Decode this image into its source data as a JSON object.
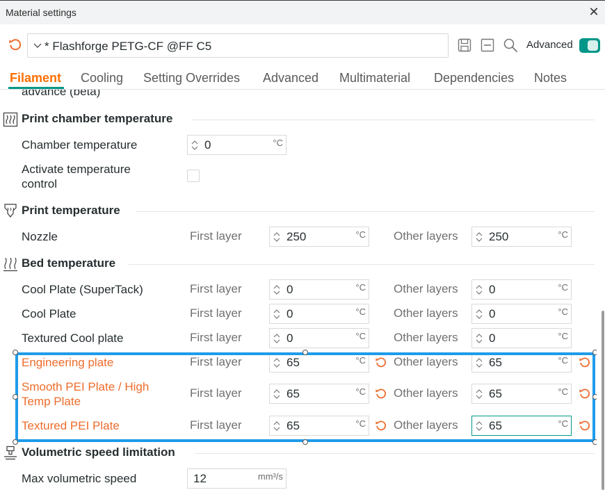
{
  "window": {
    "title": "Material settings",
    "close_label": "✕"
  },
  "preset": {
    "name": "* Flashforge PETG-CF @FF C5",
    "advanced_label": "Advanced",
    "advanced_on": true
  },
  "tabs": [
    "Filament",
    "Cooling",
    "Setting Overrides",
    "Advanced",
    "Multimaterial",
    "Dependencies",
    "Notes"
  ],
  "active_tab": "Filament",
  "clipped_text": "advance (beta)",
  "sections": {
    "chamber": {
      "title": "Print chamber temperature",
      "chamber_temp": {
        "label": "Chamber temperature",
        "value": "0",
        "unit": "°C"
      },
      "activate_control": {
        "label_line1": "Activate temperature",
        "label_line2": "control",
        "checked": false
      }
    },
    "print_temp": {
      "title": "Print temperature",
      "nozzle": {
        "label": "Nozzle",
        "first_label": "First layer",
        "first_value": "250",
        "other_label": "Other layers",
        "other_value": "250",
        "unit": "°C"
      }
    },
    "bed_temp": {
      "title": "Bed temperature",
      "rows": [
        {
          "label": "Cool Plate (SuperTack)",
          "first_label": "First layer",
          "first_value": "0",
          "other_label": "Other layers",
          "other_value": "0",
          "unit": "°C"
        },
        {
          "label": "Cool Plate",
          "first_label": "First layer",
          "first_value": "0",
          "other_label": "Other layers",
          "other_value": "0",
          "unit": "°C"
        },
        {
          "label": "Textured Cool plate",
          "first_label": "First layer",
          "first_value": "0",
          "other_label": "Other layers",
          "other_value": "0",
          "unit": "°C"
        },
        {
          "label": "Engineering plate",
          "first_label": "First layer",
          "first_value": "65",
          "other_label": "Other layers",
          "other_value": "65",
          "unit": "°C"
        },
        {
          "label_line1": "Smooth PEI Plate / High",
          "label_line2": "Temp Plate",
          "first_label": "First layer",
          "first_value": "65",
          "other_label": "Other layers",
          "other_value": "65",
          "unit": "°C"
        },
        {
          "label": "Textured PEI Plate",
          "first_label": "First layer",
          "first_value": "65",
          "other_label": "Other layers",
          "other_value": "65",
          "unit": "°C"
        }
      ]
    },
    "volumetric": {
      "title": "Volumetric speed limitation",
      "max_speed": {
        "label": "Max volumetric speed",
        "value": "12",
        "unit": "mm³/s"
      }
    }
  },
  "colors": {
    "accent": "#009688",
    "modified": "#ee6c2b",
    "active_tab": "#ff6f00",
    "selection": "#1f9bea"
  }
}
